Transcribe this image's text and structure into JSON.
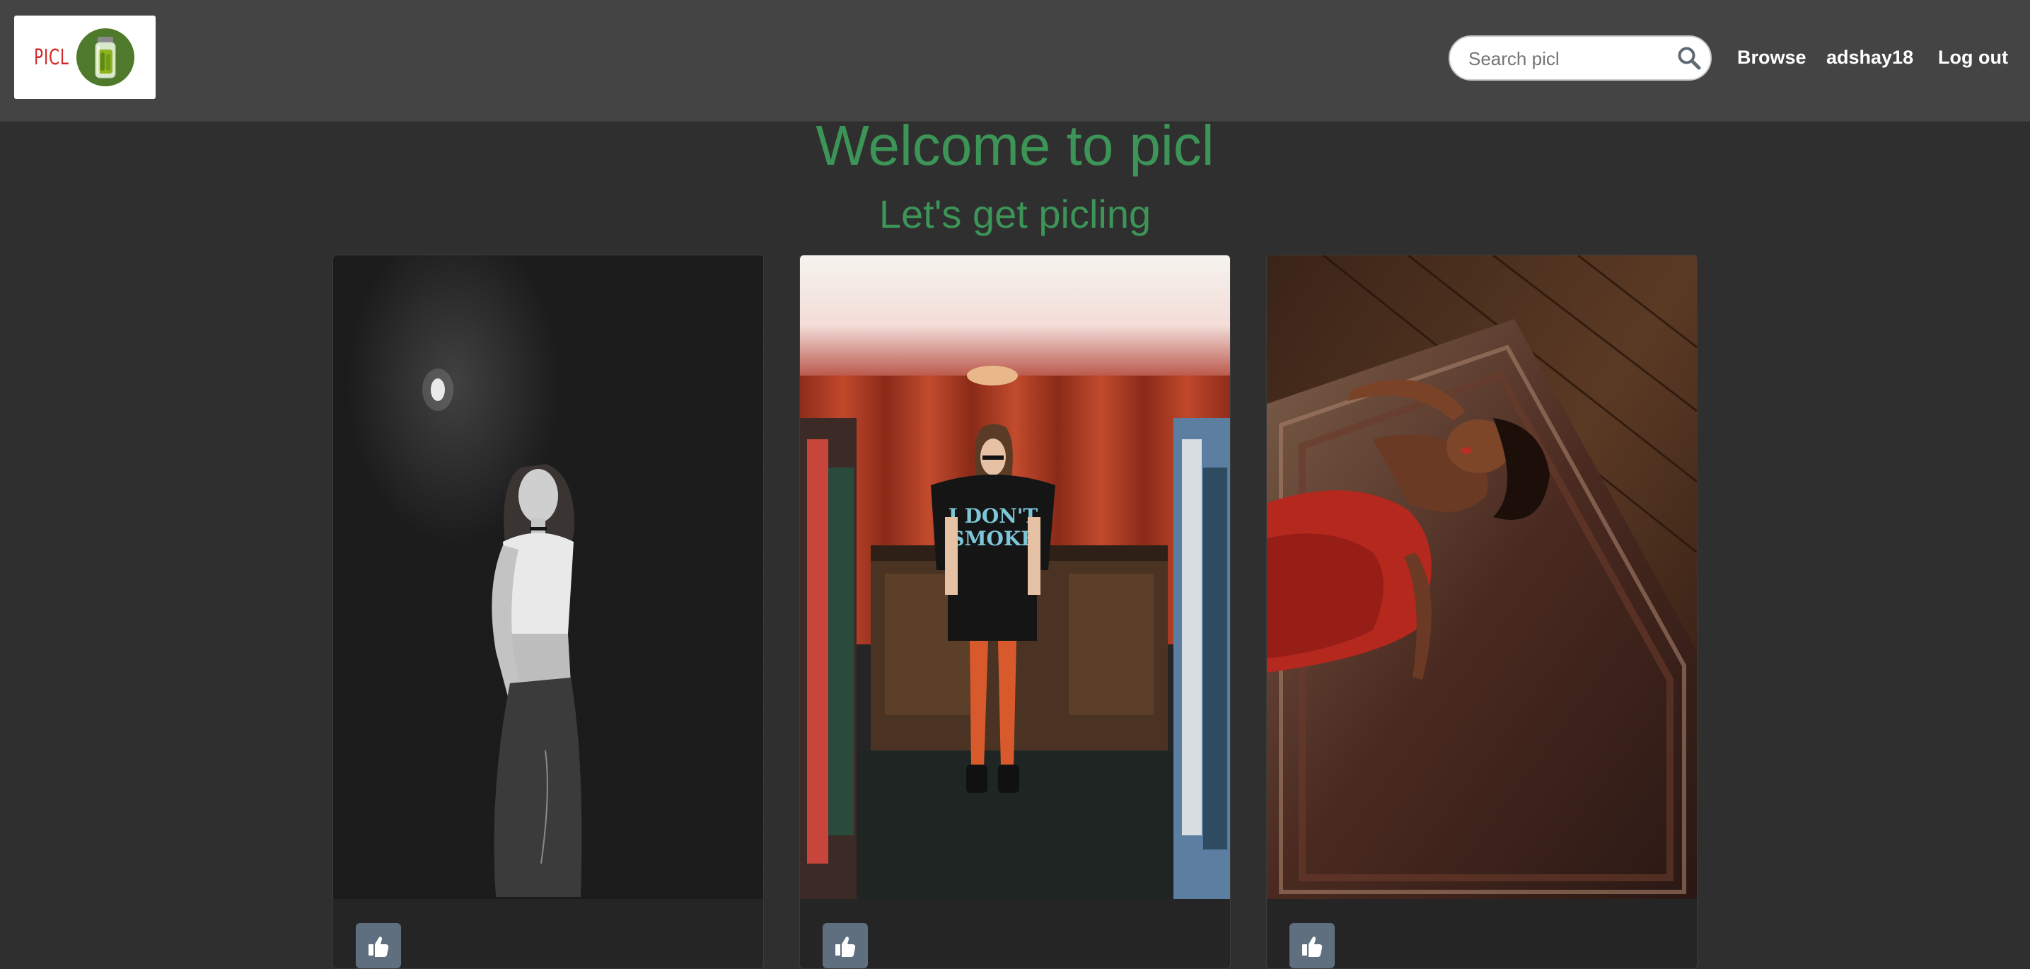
{
  "navbar": {
    "logo_text": "PICL",
    "search": {
      "placeholder": "Search picl",
      "value": ""
    },
    "links": {
      "browse": "Browse",
      "username": "adshay18",
      "logout": "Log out"
    }
  },
  "hero": {
    "title": "Welcome to picl",
    "subtitle": "Let's get picling"
  },
  "cards": [
    {
      "shirt_text": ""
    },
    {
      "shirt_text_line1": "I DON'T",
      "shirt_text_line2": "SMOKE"
    },
    {
      "shirt_text": ""
    }
  ],
  "colors": {
    "accent_green": "#3c9457",
    "navbar_bg": "#444444",
    "page_bg": "#2f2f2f",
    "logo_red": "#d42a2a",
    "like_button": "#5f6f7f"
  },
  "icons": [
    "pickle-jar-icon",
    "search-icon",
    "thumbs-up-icon"
  ]
}
